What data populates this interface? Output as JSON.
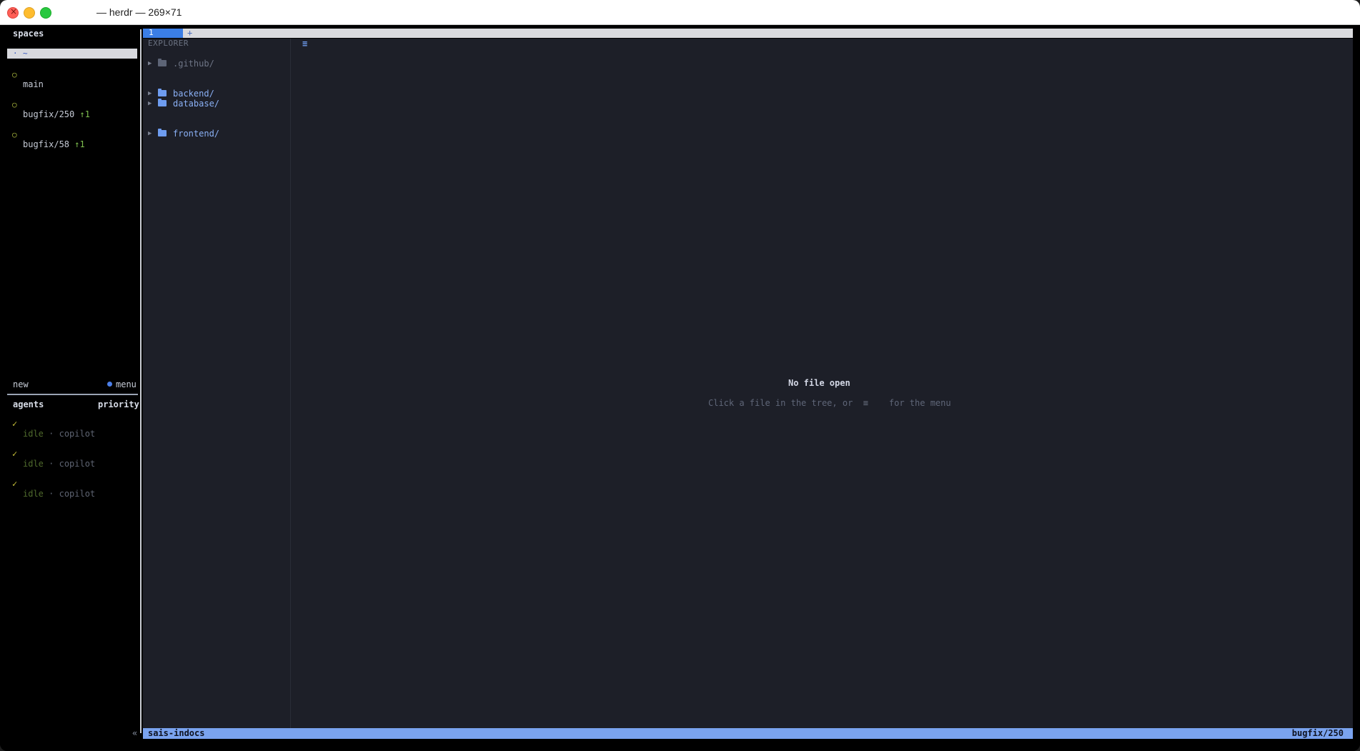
{
  "window": {
    "title": "— herdr — 269×71"
  },
  "sidebar": {
    "spaces_heading": "spaces",
    "selected_space": {
      "marker": "·",
      "name": "~"
    },
    "workspaces": [
      {
        "status_icon": "○",
        "name": "main",
        "ahead": ""
      },
      {
        "status_icon": "○",
        "name": "bugfix/250",
        "ahead": "↑1"
      },
      {
        "status_icon": "○",
        "name": "bugfix/58",
        "ahead": "↑1"
      }
    ],
    "new_label": "new",
    "menu_label": "menu",
    "agents_heading": "agents",
    "priority_label": "priority",
    "agents": [
      {
        "check": "✓",
        "state": "idle",
        "sep": "·",
        "tool": "copilot"
      },
      {
        "check": "✓",
        "state": "idle",
        "sep": "·",
        "tool": "copilot"
      },
      {
        "check": "✓",
        "state": "idle",
        "sep": "·",
        "tool": "copilot"
      }
    ],
    "collapse_icon": "«"
  },
  "tabs": {
    "active": "1",
    "add": "+"
  },
  "explorer": {
    "title": "EXPLORER",
    "items": [
      {
        "name": ".github/",
        "style": "dim"
      },
      {
        "name": "backend/",
        "style": "bright"
      },
      {
        "name": "database/",
        "style": "bright"
      },
      {
        "name": "frontend/",
        "style": "bright"
      }
    ]
  },
  "editor": {
    "menu_icon": "≡",
    "empty_title": "No file open",
    "hint_prefix": "Click a file in the tree, or",
    "hint_key": "≡",
    "hint_suffix": "for the menu"
  },
  "statusbar": {
    "left": "sais-indocs",
    "right": "bugfix/250"
  },
  "colors": {
    "accent": "#3b7ee6",
    "status_bg": "#7aa3ef",
    "panel_bg": "#1d1f28"
  }
}
